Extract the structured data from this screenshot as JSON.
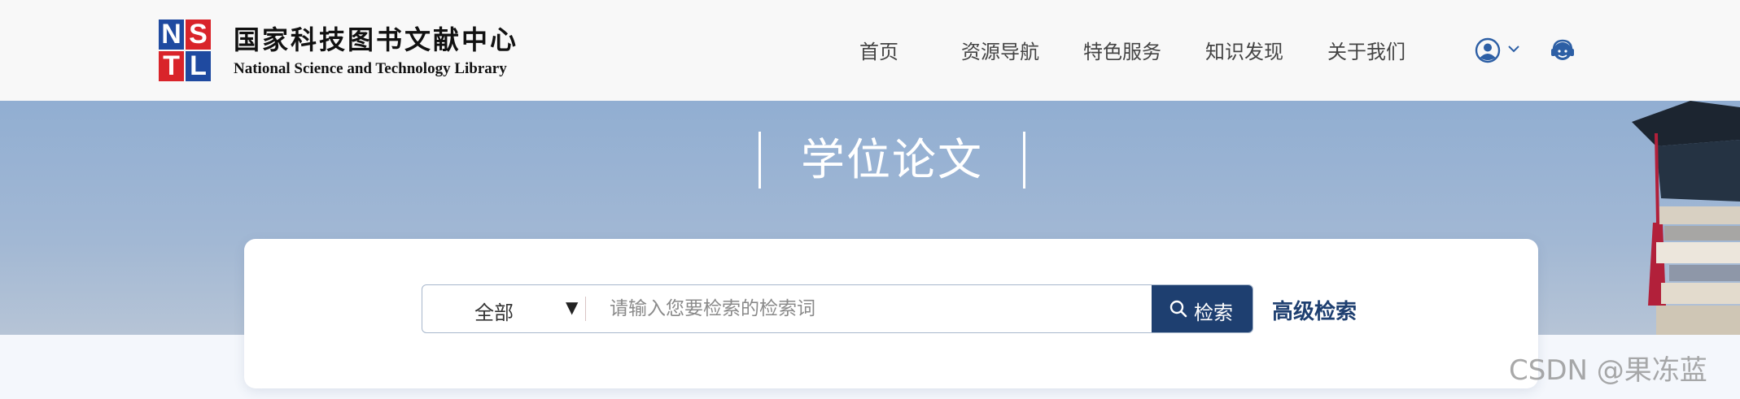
{
  "logo": {
    "mark_letters": [
      "N",
      "S",
      "T",
      "L"
    ],
    "name_cn": "国家科技图书文献中心",
    "name_en": "National Science and Technology Library"
  },
  "nav": {
    "items": [
      "首页",
      "资源导航",
      "特色服务",
      "知识发现",
      "关于我们"
    ],
    "user_icon": "user-circle-icon",
    "support_icon": "customer-service-icon"
  },
  "banner": {
    "title": "学位论文"
  },
  "search": {
    "scope_selected": "全部",
    "placeholder": "请输入您要检索的检索词",
    "value": "",
    "button_label": "检索",
    "advanced_label": "高级检索"
  },
  "watermark": "CSDN @果冻蓝",
  "colors": {
    "brand_blue": "#1e3f70",
    "logo_blue": "#1f4aa0",
    "logo_red": "#d9242a",
    "banner": "#91aed2"
  }
}
